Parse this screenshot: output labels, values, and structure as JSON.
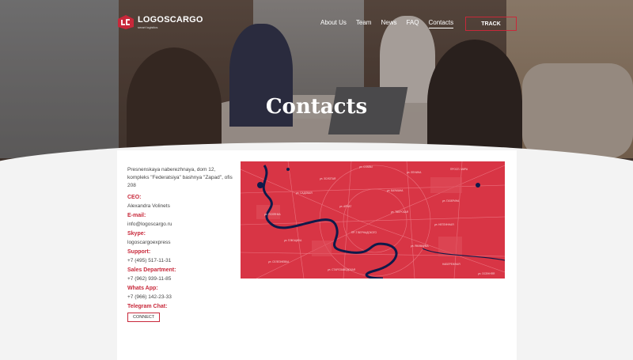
{
  "brand": {
    "name": "LOGOSCARGO",
    "tagline": "smart logistics",
    "accent": "#c8283a"
  },
  "nav": {
    "items": [
      {
        "label": "About Us"
      },
      {
        "label": "Team"
      },
      {
        "label": "News"
      },
      {
        "label": "FAQ"
      },
      {
        "label": "Contacts"
      }
    ],
    "active": "Contacts",
    "track_label": "TRACK"
  },
  "page": {
    "title": "Contacts"
  },
  "contacts": {
    "address": "Presnenskaya naberezhnaya, dom 12, kompleks \"Federatsiya\" bashnya \"Zapad\", ofis 208",
    "ceo_label": "CEO:",
    "ceo": "Alexandra Volinets",
    "email_label": "E-mail:",
    "email": "info@logoscargo.ru",
    "skype_label": "Skype:",
    "skype": "logoscargoexpress",
    "support_label": "Support:",
    "support": "+7 (495) 517-11-31",
    "sales_label": "Sales Department:",
    "sales": "+7 (962) 939-11-85",
    "whatsapp_label": "Whats App:",
    "whatsapp": "+7 (966) 142-23-33",
    "telegram_label": "Telegram Chat:",
    "connect_label": "CONNECT"
  },
  "map": {
    "colors": {
      "land": "#d83545",
      "river": "#0f1a4a",
      "roads": "#f28a95"
    },
    "labels": [
      "ул. СЛАВЫ",
      "ул. ЛЕНИНА",
      "ПРОСП. МИРА",
      "ул. ЗОЛОТАЯ",
      "ул. БАУМАНА",
      "ул. САДОВАЯ",
      "ул. ГАГАРИНА",
      "ул. АРБАТ",
      "ул. ТВЕРСКАЯ",
      "ул. ПОЛЯНКА",
      "ул. НЕГЛИННАЯ",
      "ПР-Т ВЕРНАДСКОГО",
      "ул. ПЛЮЩИХА",
      "ул. ЯКИМАНКА",
      "ул. СЕЛЕЗНЕВКА",
      "ул. СТАРОЗАВОДСКАЯ",
      "НАБЕРЕЖНАЯ",
      "ул. ОСЕННЯЯ"
    ]
  }
}
